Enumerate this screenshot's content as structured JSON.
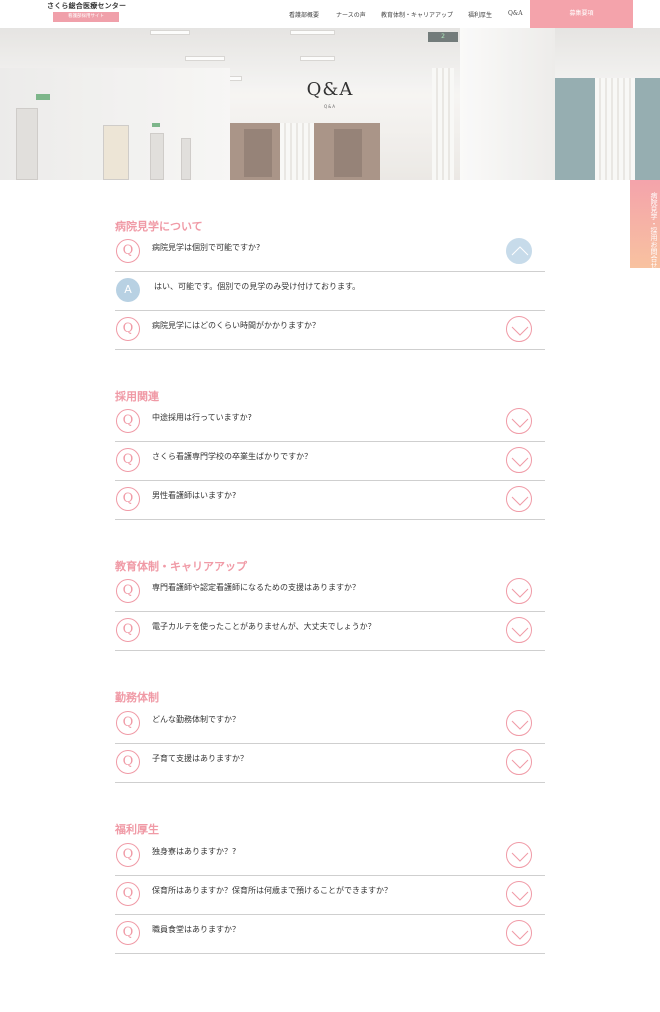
{
  "header": {
    "brand_name": "さくら総合医療センター",
    "brand_tag": "看護部採用サイト",
    "nav": [
      {
        "label": "看護部概要"
      },
      {
        "label": "ナースの声"
      },
      {
        "label": "教育体制・キャリアアップ"
      },
      {
        "label": "福利厚生"
      },
      {
        "label": "Q&A"
      }
    ],
    "recruit_label": "募集要項"
  },
  "hero": {
    "title": "Q&A",
    "subtitle": "Q&A",
    "sign_number": "2"
  },
  "side_tab": {
    "label": "病院見学・採用お問合せ"
  },
  "colors": {
    "accent_pink": "#f09aa6",
    "recruit_pink": "#f4a3ab",
    "answer_blue": "#b8d1e3"
  },
  "faq": [
    {
      "title": "病院見学について",
      "items": [
        {
          "q": "病院見学は個別で可能ですか?",
          "a": "はい、可能です。個別での見学のみ受け付けております。",
          "open": true
        },
        {
          "q": "病院見学にはどのくらい時間がかかりますか？",
          "open": false
        }
      ]
    },
    {
      "title": "採用関連",
      "items": [
        {
          "q": "中途採用は行っていますか?",
          "open": false
        },
        {
          "q": "さくら看護専門学校の卒業生ばかりですか？",
          "open": false
        },
        {
          "q": "男性看護師はいますか?",
          "open": false
        }
      ]
    },
    {
      "title": "教育体制・キャリアアップ",
      "items": [
        {
          "q": "専門看護師や認定看護師になるための支援はありますか？",
          "open": false
        },
        {
          "q": "電子カルテを使ったことがありませんが、大丈夫でしょうか？",
          "open": false
        }
      ]
    },
    {
      "title": "勤務体制",
      "items": [
        {
          "q": "どんな勤務体制ですか？",
          "open": false
        },
        {
          "q": "子育て支援はありますか？",
          "open": false
        }
      ]
    },
    {
      "title": "福利厚生",
      "items": [
        {
          "q": "独身寮はありますか？?",
          "open": false
        },
        {
          "q": "保育所はありますか？保育所は何歳まで預けることができますか？",
          "open": false
        },
        {
          "q": "職員食堂はありますか？",
          "open": false
        }
      ]
    }
  ],
  "badges": {
    "q": "Q",
    "a": "A"
  },
  "icons": {
    "toggle_open": "chevron-up-icon",
    "toggle_closed": "chevron-down-icon"
  }
}
